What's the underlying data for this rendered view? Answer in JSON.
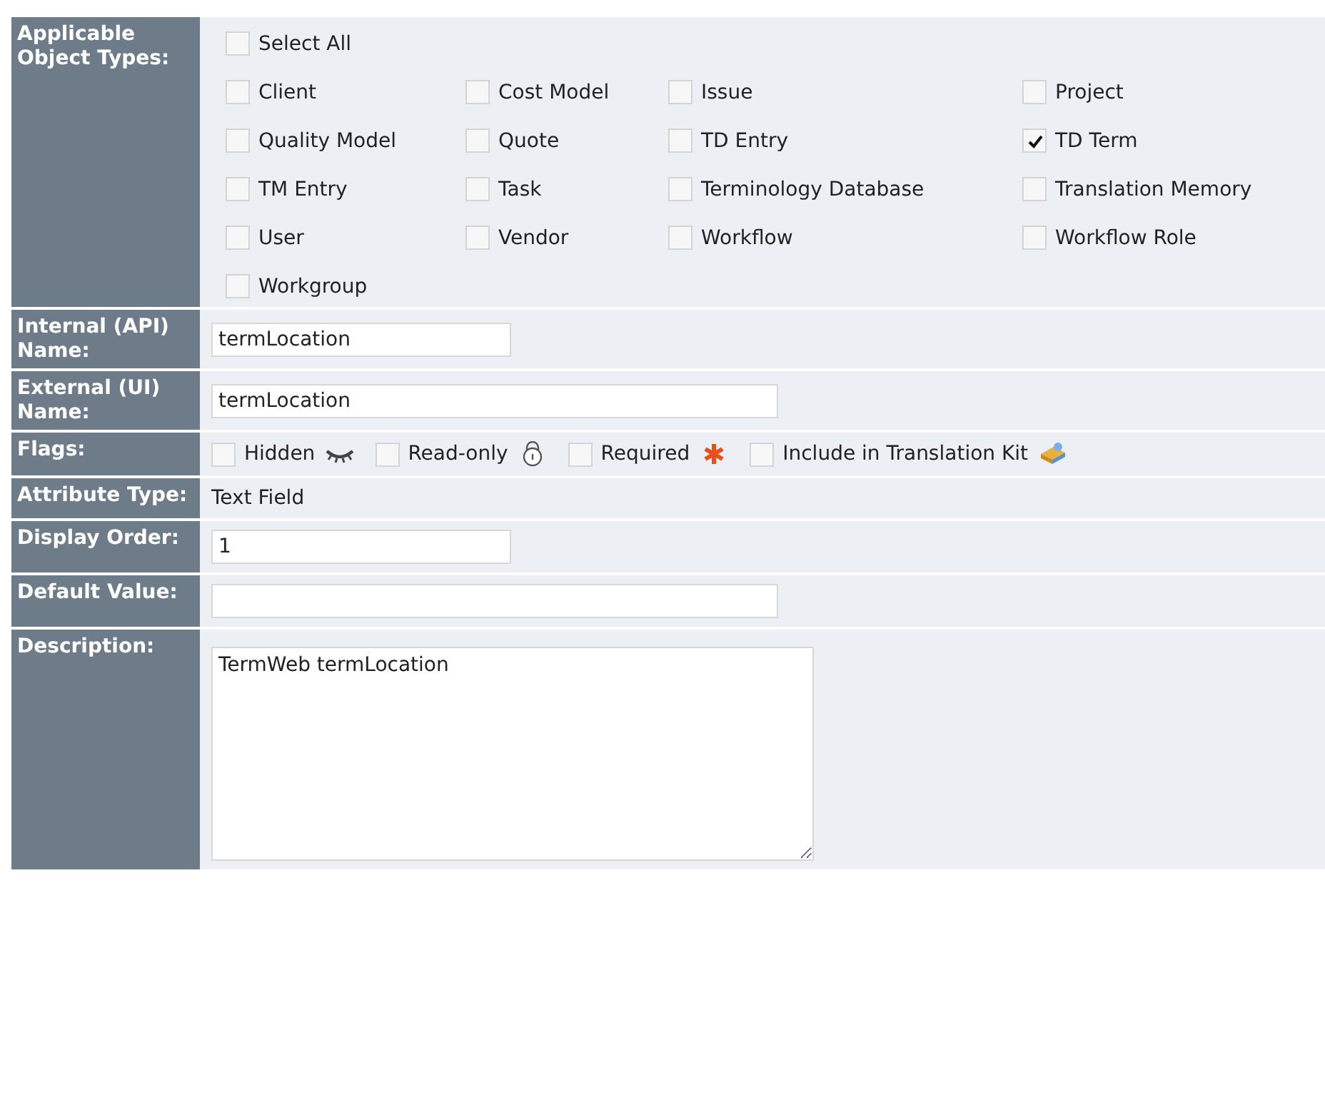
{
  "object_types": {
    "label": "Applicable Object Types:",
    "select_all": {
      "label": "Select All",
      "checked": false
    },
    "items": [
      {
        "label": "Client",
        "checked": false
      },
      {
        "label": "Cost Model",
        "checked": false
      },
      {
        "label": "Issue",
        "checked": false
      },
      {
        "label": "Project",
        "checked": false
      },
      {
        "label": "Quality Model",
        "checked": false
      },
      {
        "label": "Quote",
        "checked": false
      },
      {
        "label": "TD Entry",
        "checked": false
      },
      {
        "label": "TD Term",
        "checked": true
      },
      {
        "label": "TM Entry",
        "checked": false
      },
      {
        "label": "Task",
        "checked": false
      },
      {
        "label": "Terminology Database",
        "checked": false
      },
      {
        "label": "Translation Memory",
        "checked": false
      },
      {
        "label": "User",
        "checked": false
      },
      {
        "label": "Vendor",
        "checked": false
      },
      {
        "label": "Workflow",
        "checked": false
      },
      {
        "label": "Workflow Role",
        "checked": false
      },
      {
        "label": "Workgroup",
        "checked": false
      }
    ]
  },
  "internal_name": {
    "label": "Internal (API) Name:",
    "value": "termLocation"
  },
  "external_name": {
    "label": "External (UI) Name:",
    "value": "termLocation"
  },
  "flags": {
    "label": "Flags:",
    "items": [
      {
        "label": "Hidden",
        "checked": false,
        "kind": "hidden"
      },
      {
        "label": "Read-only",
        "checked": false,
        "kind": "readonly"
      },
      {
        "label": "Required",
        "checked": false,
        "kind": "required"
      },
      {
        "label": "Include in Translation Kit",
        "checked": false,
        "kind": "kit"
      }
    ]
  },
  "attribute_type": {
    "label": "Attribute Type:",
    "value": "Text Field"
  },
  "display_order": {
    "label": "Display Order:",
    "value": "1"
  },
  "default_value": {
    "label": "Default Value:"
  },
  "description": {
    "label": "Description:",
    "value": "TermWeb termLocation"
  }
}
